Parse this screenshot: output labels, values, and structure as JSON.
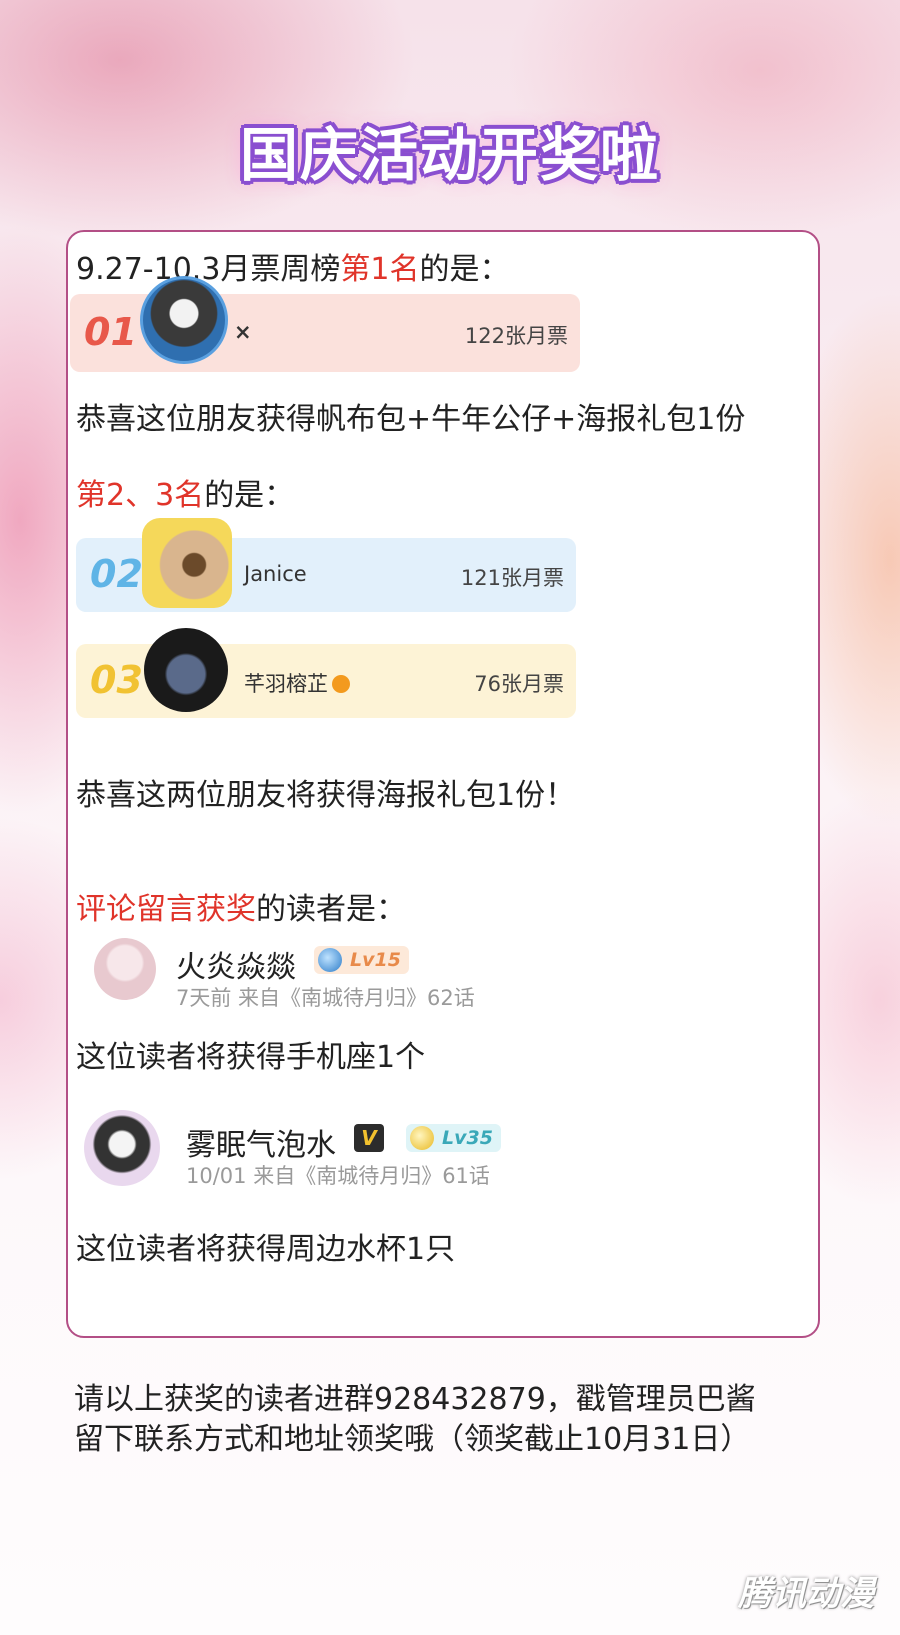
{
  "title": "国庆活动开奖啦",
  "section1": {
    "heading_prefix": "9.27-10.3月票周榜",
    "heading_highlight": "第1名",
    "heading_suffix": "的是：",
    "winner": {
      "rank": "01",
      "name": "×",
      "votes": "122张月票"
    },
    "prize": "恭喜这位朋友获得帆布包+牛年公仔+海报礼包1份"
  },
  "section2": {
    "heading_highlight": "第2、3名",
    "heading_suffix": "的是：",
    "winners": [
      {
        "rank": "02",
        "name": "Janice",
        "votes": "121张月票"
      },
      {
        "rank": "03",
        "name": "芊羽榕芷",
        "votes": "76张月票"
      }
    ],
    "prize": "恭喜这两位朋友将获得海报礼包1份！"
  },
  "section3": {
    "heading_highlight": "评论留言获奖",
    "heading_suffix": "的读者是：",
    "comments": [
      {
        "name": "火炎焱燚",
        "level": "Lv15",
        "meta": "7天前  来自《南城待月归》62话",
        "prize": "这位读者将获得手机座1个"
      },
      {
        "name": "雾眠气泡水",
        "vip": "V",
        "level": "Lv35",
        "meta": "10/01  来自《南城待月归》61话",
        "prize": "这位读者将获得周边水杯1只"
      }
    ]
  },
  "footer": {
    "line1": "请以上获奖的读者进群928432879，戳管理员巴酱",
    "line2": "留下联系方式和地址领奖哦（领奖截止10月31日）"
  },
  "watermark": "腾讯动漫",
  "colors": {
    "highlight": "#e0342a",
    "rank1_bg": "#fbe1dc",
    "rank2_bg": "#e2f0fb",
    "rank3_bg": "#fdf3d6",
    "card_border": "#b34f86"
  }
}
